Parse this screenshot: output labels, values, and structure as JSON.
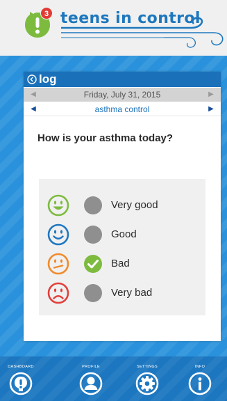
{
  "header": {
    "brand": "teens in control",
    "notification_count": "3",
    "brand_color": "#1d77bd",
    "alert_icon": "exclamation-badge-icon"
  },
  "log": {
    "title": "log",
    "date": "Friday, July 31, 2015",
    "topic": "asthma control",
    "question": "How is your asthma today?"
  },
  "options": [
    {
      "label": "Very good",
      "face": "big-smile-face-icon",
      "color": "#7dbb3f",
      "selected": false
    },
    {
      "label": "Good",
      "face": "smile-face-icon",
      "color": "#1f78c1",
      "selected": false
    },
    {
      "label": "Bad",
      "face": "meh-face-icon",
      "color": "#ef8b2c",
      "selected": true
    },
    {
      "label": "Very bad",
      "face": "frown-face-icon",
      "color": "#e2403b",
      "selected": false
    }
  ],
  "nav": [
    {
      "label": "DASHBOARD",
      "icon": "dashboard-icon"
    },
    {
      "label": "PROFILE",
      "icon": "profile-icon"
    },
    {
      "label": "SETTINGS",
      "icon": "gear-icon"
    },
    {
      "label": "INFO",
      "icon": "info-icon"
    }
  ],
  "colors": {
    "panel_blue": "#2a92dc",
    "bar_blue": "#1a71ba",
    "selected_green": "#7dbb3f",
    "radio_grey": "#8f8f8f"
  }
}
